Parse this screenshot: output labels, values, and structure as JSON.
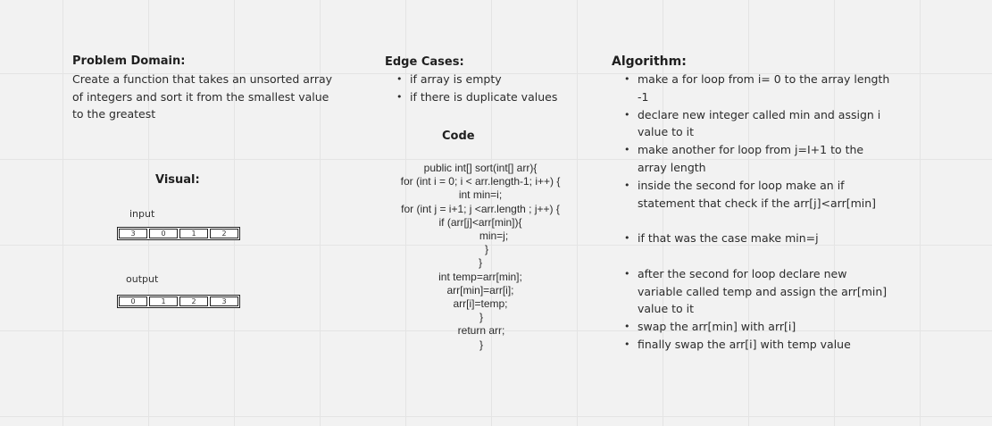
{
  "problem": {
    "heading": "Problem Domain:",
    "lines": [
      "Create a function that takes an unsorted array",
      "of integers and sort it from the smallest value",
      "to the greatest"
    ]
  },
  "edge_cases": {
    "heading": "Edge Cases:",
    "items": [
      "if array is empty",
      "if there is duplicate values"
    ]
  },
  "code": {
    "heading": "Code",
    "lines": [
      "public int[] sort(int[] arr){",
      "for (int i = 0; i < arr.length-1; i++) {",
      "int min=i;",
      "for (int j = i+1; j <arr.length ; j++) {",
      "if (arr[j]<arr[min]){",
      "min=j;",
      "}",
      "}",
      "int temp=arr[min];",
      "arr[min]=arr[i];",
      "arr[i]=temp;",
      "}",
      "return arr;",
      "}"
    ]
  },
  "algorithm": {
    "heading": "Algorithm:",
    "items": [
      "make a for loop from i= 0 to the array length -1",
      "declare new integer called min and assign i value to it",
      "make another for loop from j=I+1 to the array length",
      "inside the second for loop make an if statement that check if the arr[j]<arr[min]",
      "if that was the case make min=j",
      "after the second for loop declare new variable called temp and assign the arr[min] value to it",
      "swap the arr[min] with arr[i]",
      "finally swap the arr[i] with temp value"
    ]
  },
  "visual": {
    "heading": "Visual:",
    "input_label": "input",
    "input_values": [
      "3",
      "0",
      "1",
      "2"
    ],
    "output_label": "output",
    "output_values": [
      "0",
      "1",
      "2",
      "3"
    ]
  }
}
